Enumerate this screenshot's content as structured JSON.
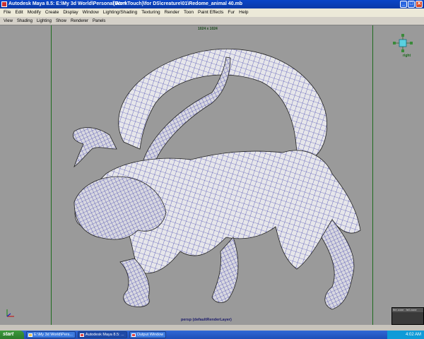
{
  "window": {
    "title": "Autodesk Maya 8.5: E:\\My 3d World\\Personal Work",
    "title_path": "(Dont Touch)\\for DS\\creature\\01\\Redome_animal 40.mb",
    "buttons": [
      "_",
      "□",
      "✕"
    ]
  },
  "menubar": {
    "items": [
      "File",
      "Edit",
      "Modify",
      "Create",
      "Display",
      "Window",
      "Lighting/Shading",
      "Texturing",
      "Render",
      "Toon",
      "Paint Effects",
      "Fur",
      "Help"
    ]
  },
  "panel_menu": {
    "items": [
      "View",
      "Shading",
      "Lighting",
      "Show",
      "Renderer",
      "Panels"
    ]
  },
  "viewport": {
    "resolution_label": "1024 x 1024",
    "camera_label": "persp (defaultRenderLayer)",
    "viewcube_label": "right",
    "wireframe_color": "#1a1aa0",
    "background_color": "#9a9a9a",
    "zone_label": "fire zone : fell zone"
  },
  "taskbar": {
    "start_label": "start",
    "tasks": [
      {
        "label": "E:\\My 3d World\\Pers...",
        "icon": "folder-icon"
      },
      {
        "label": "Autodesk Maya 8.5: ...",
        "icon": "maya-icon"
      },
      {
        "label": "Output Window",
        "icon": "maya-icon"
      }
    ],
    "clock": "4:02 AM"
  }
}
